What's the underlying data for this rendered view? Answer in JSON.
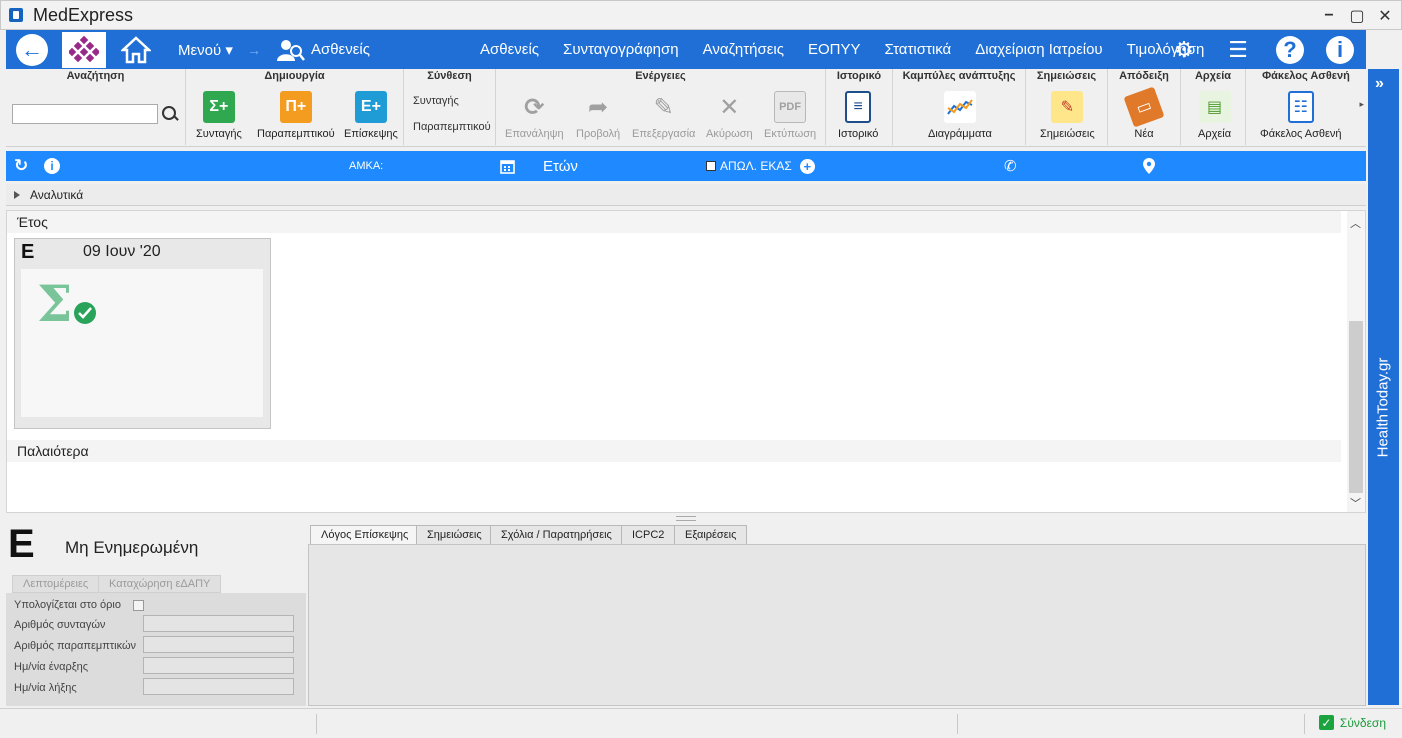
{
  "window": {
    "title": "MedExpress"
  },
  "nav": {
    "menu_label": "Μενού",
    "patients_label": "Ασθενείς",
    "links": [
      "Ασθενείς",
      "Συνταγογράφηση",
      "Αναζητήσεις",
      "ΕΟΠΥΥ",
      "Στατιστικά",
      "Διαχείριση Ιατρείου",
      "Τιμολόγηση"
    ]
  },
  "ribbon": {
    "search": {
      "title": "Αναζήτηση",
      "value": ""
    },
    "create": {
      "title": "Δημιουργία",
      "prescription": "Συνταγής",
      "referral": "Παραπεμπτικού",
      "visit": "Επίσκεψης"
    },
    "compose": {
      "title": "Σύνθεση",
      "prescription": "Συνταγής",
      "referral": "Παραπεμπτικού"
    },
    "actions": {
      "title": "Ενέργειες",
      "repeat": "Επανάληψη",
      "view": "Προβολή",
      "edit": "Επεξεργασία",
      "cancel": "Ακύρωση",
      "print": "Εκτύπωση"
    },
    "history": {
      "title": "Ιστορικό",
      "button": "Ιστορικό"
    },
    "growth": {
      "title": "Καμπύλες ανάπτυξης",
      "button": "Διαγράμματα"
    },
    "notes": {
      "title": "Σημειώσεις",
      "button": "Σημειώσεις"
    },
    "receipt": {
      "title": "Απόδειξη",
      "button": "Νέα"
    },
    "files": {
      "title": "Αρχεία",
      "button": "Αρχεία"
    },
    "folder": {
      "title": "Φάκελος Ασθενή",
      "button": "Φάκελος Ασθενή"
    }
  },
  "infobar": {
    "amka_label": "ΑΜΚΑ:",
    "age_label": "Ετών",
    "deceased_label": "ΑΠΩΛ. ΕΚΑΣ"
  },
  "analytics": {
    "label": "Αναλυτικά"
  },
  "timeline": {
    "year_header": "Έτος",
    "card": {
      "letter": "Ε",
      "date": "09 Ιουν '20"
    },
    "older_header": "Παλαιότερα"
  },
  "sidebar": {
    "brand": "HealthToday.gr"
  },
  "details": {
    "letter": "Ε",
    "status": "Μη Ενημερωμένη",
    "subtabs": [
      "Λεπτομέρειες",
      "Καταχώρηση εΔΑΠΥ"
    ],
    "fields": [
      {
        "label": "Υπολογίζεται στο όριο"
      },
      {
        "label": "Αριθμός συνταγών",
        "value": ""
      },
      {
        "label": "Αριθμός παραπεμπτικών",
        "value": ""
      },
      {
        "label": "Ημ/νία έναρξης",
        "value": ""
      },
      {
        "label": "Ημ/νία λήξης",
        "value": ""
      }
    ]
  },
  "tabs": [
    "Λόγος Επίσκεψης",
    "Σημειώσεις",
    "Σχόλια / Παρατηρήσεις",
    "ICPC2",
    "Εξαιρέσεις"
  ],
  "statusbar": {
    "connection": "Σύνδεση"
  }
}
